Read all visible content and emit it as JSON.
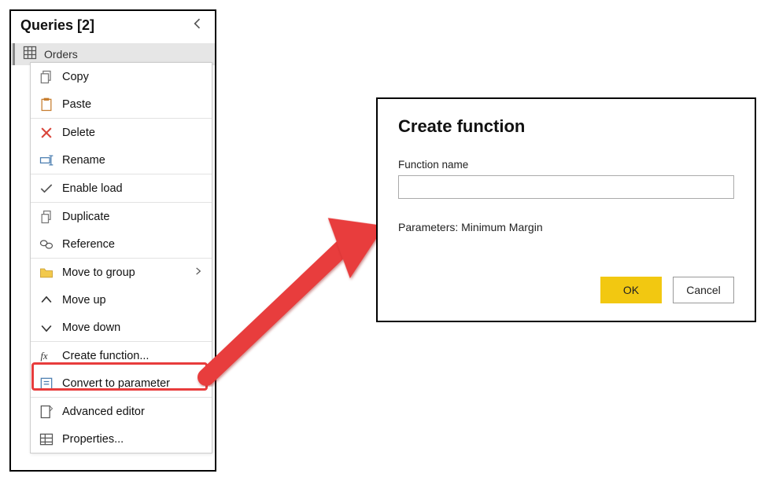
{
  "panel": {
    "title": "Queries [2]",
    "selected_query": "Orders"
  },
  "context_menu": {
    "copy": "Copy",
    "paste": "Paste",
    "delete": "Delete",
    "rename": "Rename",
    "enable_load": "Enable load",
    "duplicate": "Duplicate",
    "reference": "Reference",
    "move_to_group": "Move to group",
    "move_up": "Move up",
    "move_down": "Move down",
    "create_function": "Create function...",
    "convert_to_parameter": "Convert to parameter",
    "advanced_editor": "Advanced editor",
    "properties": "Properties..."
  },
  "dialog": {
    "title": "Create function",
    "field_label": "Function name",
    "field_value": "",
    "parameters_text": "Parameters: Minimum Margin",
    "ok": "OK",
    "cancel": "Cancel"
  }
}
